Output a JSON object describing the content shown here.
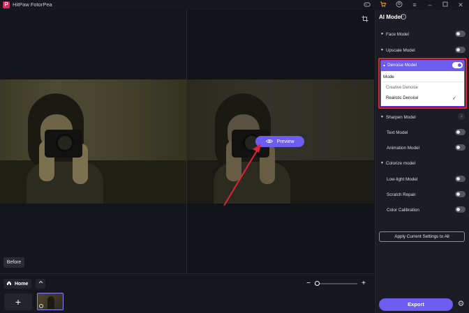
{
  "app": {
    "logo": "P",
    "title": "HitPaw FotorPea"
  },
  "titlebar_icons": [
    "gamepad-icon",
    "cart-icon",
    "user-icon",
    "menu-icon",
    "minimize-icon",
    "maximize-icon",
    "close-icon"
  ],
  "canvas": {
    "before_label": "Before",
    "preview_label": "Preview"
  },
  "bottom": {
    "home_label": "Home",
    "zoom_minus": "−",
    "zoom_plus": "+",
    "zoom_level": 0.05,
    "add_label": "+"
  },
  "panel": {
    "title": "AI Model",
    "models": [
      {
        "label": "Face Model",
        "caret": "▼",
        "toggle": false
      },
      {
        "label": "Upscale Model",
        "caret": "▼",
        "toggle": false
      },
      {
        "label": "Denoise Model",
        "caret": "▲",
        "toggle": true,
        "expanded": true
      },
      {
        "label": "Sharpen Model",
        "caret": "▼",
        "download": true
      },
      {
        "label": "Text Model",
        "toggle": false,
        "child": true
      },
      {
        "label": "Animation Model",
        "toggle": false,
        "child": true
      },
      {
        "label": "Colorize model",
        "caret": "▼",
        "toggle": false
      },
      {
        "label": "Low-light Model",
        "toggle": false,
        "child": true
      },
      {
        "label": "Scratch Repair",
        "toggle": false,
        "child": true
      },
      {
        "label": "Color Calibration",
        "toggle": false,
        "child": true
      }
    ],
    "dropdown": {
      "header": "Mode",
      "options": [
        "Creative Denoise",
        "Realistic Denoise"
      ],
      "selected": "Realistic Denoise"
    },
    "apply_label": "Apply Current Settings to All",
    "export_label": "Export"
  },
  "colors": {
    "accent": "#6d5cf0",
    "highlight": "#e02436",
    "panel_bg": "#1c1c24"
  }
}
